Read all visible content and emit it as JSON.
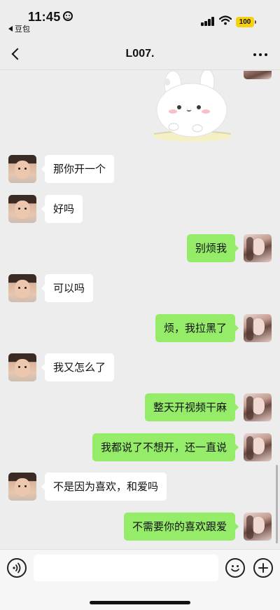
{
  "status_bar": {
    "time": "11:45",
    "back_app": "豆包",
    "battery": "100"
  },
  "nav": {
    "title": "L007."
  },
  "messages": [
    {
      "side": "in",
      "text": "那你开一个"
    },
    {
      "side": "in",
      "text": "好吗"
    },
    {
      "side": "out",
      "text": "别烦我"
    },
    {
      "side": "in",
      "text": "可以吗"
    },
    {
      "side": "out",
      "text": "烦，我拉黑了"
    },
    {
      "side": "in",
      "text": "我又怎么了"
    },
    {
      "side": "out",
      "text": "整天开视频干麻"
    },
    {
      "side": "out",
      "text": "我都说了不想开，还一直说"
    },
    {
      "side": "in",
      "text": "不是因为喜欢，和爱吗"
    },
    {
      "side": "out",
      "text": "不需要你的喜欢跟爱"
    }
  ],
  "colors": {
    "background": "#ededed",
    "outgoing_bubble": "#95ec69",
    "incoming_bubble": "#ffffff",
    "battery": "#f6d10c"
  },
  "icons": [
    "back-chevron-icon",
    "more-icon",
    "voice-icon",
    "emoji-icon",
    "plus-icon",
    "signal-icon",
    "wifi-icon",
    "battery-icon"
  ]
}
